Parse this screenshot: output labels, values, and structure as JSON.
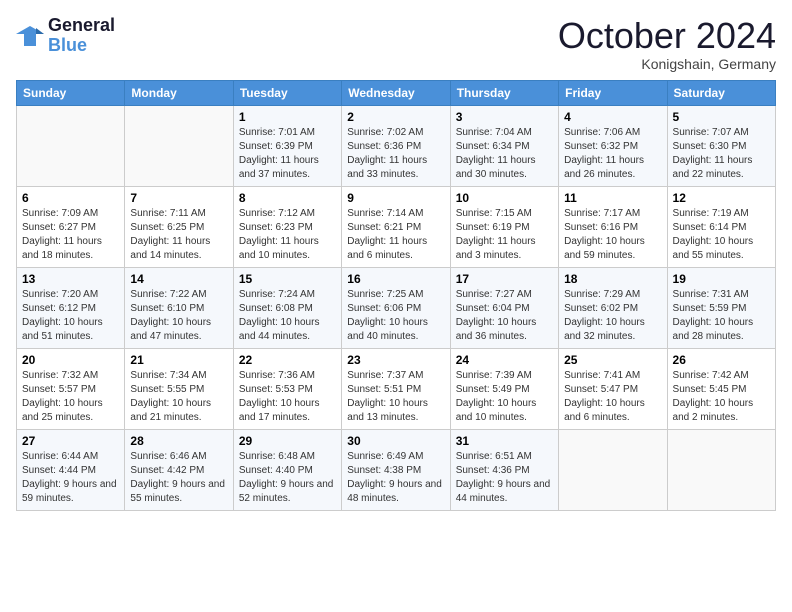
{
  "header": {
    "logo_line1": "General",
    "logo_line2": "Blue",
    "month": "October 2024",
    "location": "Konigshain, Germany"
  },
  "days_of_week": [
    "Sunday",
    "Monday",
    "Tuesday",
    "Wednesday",
    "Thursday",
    "Friday",
    "Saturday"
  ],
  "weeks": [
    [
      {
        "day": "",
        "details": ""
      },
      {
        "day": "",
        "details": ""
      },
      {
        "day": "1",
        "details": "Sunrise: 7:01 AM\nSunset: 6:39 PM\nDaylight: 11 hours and 37 minutes."
      },
      {
        "day": "2",
        "details": "Sunrise: 7:02 AM\nSunset: 6:36 PM\nDaylight: 11 hours and 33 minutes."
      },
      {
        "day": "3",
        "details": "Sunrise: 7:04 AM\nSunset: 6:34 PM\nDaylight: 11 hours and 30 minutes."
      },
      {
        "day": "4",
        "details": "Sunrise: 7:06 AM\nSunset: 6:32 PM\nDaylight: 11 hours and 26 minutes."
      },
      {
        "day": "5",
        "details": "Sunrise: 7:07 AM\nSunset: 6:30 PM\nDaylight: 11 hours and 22 minutes."
      }
    ],
    [
      {
        "day": "6",
        "details": "Sunrise: 7:09 AM\nSunset: 6:27 PM\nDaylight: 11 hours and 18 minutes."
      },
      {
        "day": "7",
        "details": "Sunrise: 7:11 AM\nSunset: 6:25 PM\nDaylight: 11 hours and 14 minutes."
      },
      {
        "day": "8",
        "details": "Sunrise: 7:12 AM\nSunset: 6:23 PM\nDaylight: 11 hours and 10 minutes."
      },
      {
        "day": "9",
        "details": "Sunrise: 7:14 AM\nSunset: 6:21 PM\nDaylight: 11 hours and 6 minutes."
      },
      {
        "day": "10",
        "details": "Sunrise: 7:15 AM\nSunset: 6:19 PM\nDaylight: 11 hours and 3 minutes."
      },
      {
        "day": "11",
        "details": "Sunrise: 7:17 AM\nSunset: 6:16 PM\nDaylight: 10 hours and 59 minutes."
      },
      {
        "day": "12",
        "details": "Sunrise: 7:19 AM\nSunset: 6:14 PM\nDaylight: 10 hours and 55 minutes."
      }
    ],
    [
      {
        "day": "13",
        "details": "Sunrise: 7:20 AM\nSunset: 6:12 PM\nDaylight: 10 hours and 51 minutes."
      },
      {
        "day": "14",
        "details": "Sunrise: 7:22 AM\nSunset: 6:10 PM\nDaylight: 10 hours and 47 minutes."
      },
      {
        "day": "15",
        "details": "Sunrise: 7:24 AM\nSunset: 6:08 PM\nDaylight: 10 hours and 44 minutes."
      },
      {
        "day": "16",
        "details": "Sunrise: 7:25 AM\nSunset: 6:06 PM\nDaylight: 10 hours and 40 minutes."
      },
      {
        "day": "17",
        "details": "Sunrise: 7:27 AM\nSunset: 6:04 PM\nDaylight: 10 hours and 36 minutes."
      },
      {
        "day": "18",
        "details": "Sunrise: 7:29 AM\nSunset: 6:02 PM\nDaylight: 10 hours and 32 minutes."
      },
      {
        "day": "19",
        "details": "Sunrise: 7:31 AM\nSunset: 5:59 PM\nDaylight: 10 hours and 28 minutes."
      }
    ],
    [
      {
        "day": "20",
        "details": "Sunrise: 7:32 AM\nSunset: 5:57 PM\nDaylight: 10 hours and 25 minutes."
      },
      {
        "day": "21",
        "details": "Sunrise: 7:34 AM\nSunset: 5:55 PM\nDaylight: 10 hours and 21 minutes."
      },
      {
        "day": "22",
        "details": "Sunrise: 7:36 AM\nSunset: 5:53 PM\nDaylight: 10 hours and 17 minutes."
      },
      {
        "day": "23",
        "details": "Sunrise: 7:37 AM\nSunset: 5:51 PM\nDaylight: 10 hours and 13 minutes."
      },
      {
        "day": "24",
        "details": "Sunrise: 7:39 AM\nSunset: 5:49 PM\nDaylight: 10 hours and 10 minutes."
      },
      {
        "day": "25",
        "details": "Sunrise: 7:41 AM\nSunset: 5:47 PM\nDaylight: 10 hours and 6 minutes."
      },
      {
        "day": "26",
        "details": "Sunrise: 7:42 AM\nSunset: 5:45 PM\nDaylight: 10 hours and 2 minutes."
      }
    ],
    [
      {
        "day": "27",
        "details": "Sunrise: 6:44 AM\nSunset: 4:44 PM\nDaylight: 9 hours and 59 minutes."
      },
      {
        "day": "28",
        "details": "Sunrise: 6:46 AM\nSunset: 4:42 PM\nDaylight: 9 hours and 55 minutes."
      },
      {
        "day": "29",
        "details": "Sunrise: 6:48 AM\nSunset: 4:40 PM\nDaylight: 9 hours and 52 minutes."
      },
      {
        "day": "30",
        "details": "Sunrise: 6:49 AM\nSunset: 4:38 PM\nDaylight: 9 hours and 48 minutes."
      },
      {
        "day": "31",
        "details": "Sunrise: 6:51 AM\nSunset: 4:36 PM\nDaylight: 9 hours and 44 minutes."
      },
      {
        "day": "",
        "details": ""
      },
      {
        "day": "",
        "details": ""
      }
    ]
  ]
}
